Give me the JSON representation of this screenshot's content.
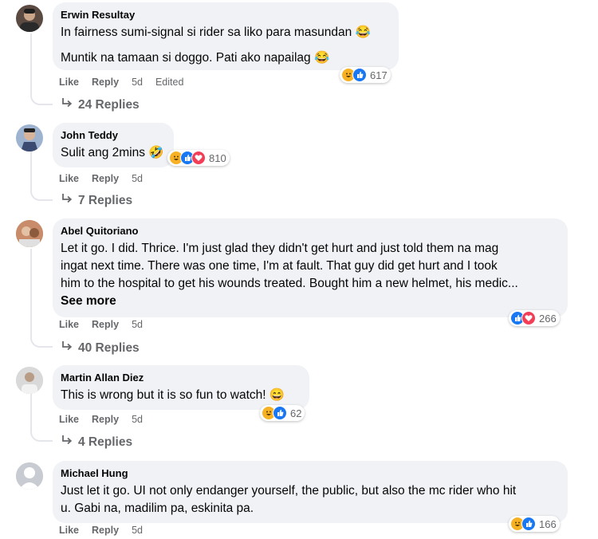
{
  "comments": [
    {
      "author": "Erwin Resultay",
      "lines": [
        "In fairness sumi-signal si rider sa liko para masundan 😂",
        "Muntik na tamaan si doggo. Pati ako napailag 😂"
      ],
      "like": "Like",
      "reply": "Reply",
      "age": "5d",
      "edited": "Edited",
      "reaction_count": "617",
      "reactions": [
        "haha",
        "like"
      ],
      "replies": "24 Replies"
    },
    {
      "author": "John Teddy",
      "lines": [
        "Sulit ang 2mins 🤣"
      ],
      "like": "Like",
      "reply": "Reply",
      "age": "5d",
      "reaction_count": "810",
      "reactions": [
        "haha",
        "like",
        "love"
      ],
      "replies": "7 Replies"
    },
    {
      "author": "Abel Quitoriano",
      "lines": [
        "Let it go. I did. Thrice. I'm just glad they didn't get hurt and just told them na mag",
        "ingat next time. There was one time, I'm at fault. That guy did get hurt and I took",
        "him to the hospital to get his wounds treated. Bought him a new helmet, his medic..."
      ],
      "see_more": "See more",
      "like": "Like",
      "reply": "Reply",
      "age": "5d",
      "reaction_count": "266",
      "reactions": [
        "like",
        "love"
      ],
      "replies": "40 Replies"
    },
    {
      "author": "Martin Allan Diez",
      "lines": [
        "This is wrong but it is so fun to watch! 😄"
      ],
      "like": "Like",
      "reply": "Reply",
      "age": "5d",
      "reaction_count": "62",
      "reactions": [
        "haha",
        "like"
      ],
      "replies": "4 Replies"
    },
    {
      "author": "Michael Hung",
      "lines": [
        "Just let it go. UI not only endanger yourself, the public, but also the mc rider who hit",
        "u. Gabi na, madilim pa, eskinita pa."
      ],
      "like": "Like",
      "reply": "Reply",
      "age": "5d",
      "reaction_count": "166",
      "reactions": [
        "haha",
        "like"
      ]
    }
  ],
  "colors": {
    "bubble": "#f0f2f5",
    "meta": "#65676b",
    "like": "#1877f2",
    "love": "#f33e58",
    "haha": "#f7b125"
  }
}
